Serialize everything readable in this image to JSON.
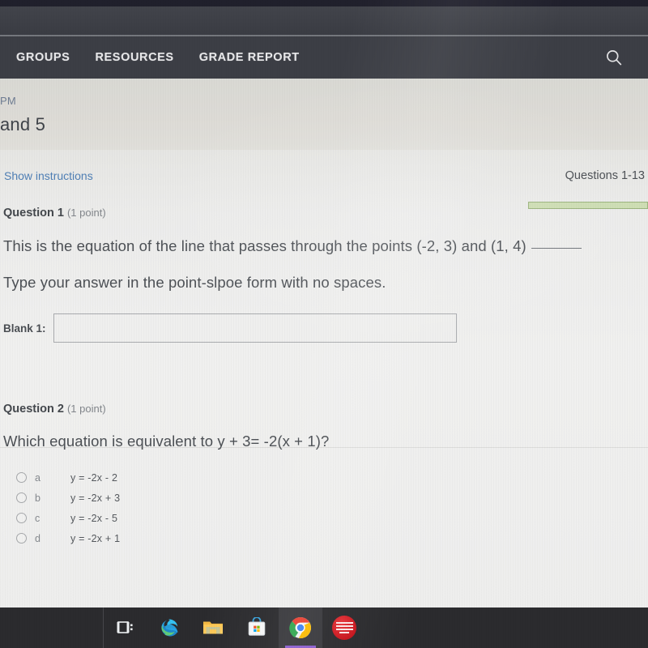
{
  "browser": {
    "chrome_strip": "dark-window-chrome"
  },
  "navbar": {
    "items": [
      {
        "label": "GROUPS",
        "name": "nav-item-groups"
      },
      {
        "label": "RESOURCES",
        "name": "nav-item-resources"
      },
      {
        "label": "GRADE REPORT",
        "name": "nav-item-grade-report"
      }
    ],
    "search_icon": "search-icon"
  },
  "page_header": {
    "time": "PM",
    "title": "and 5"
  },
  "instructions": {
    "show_instructions_label": "Show instructions",
    "questions_range": "Questions 1-13",
    "progress_percent": 100,
    "progress_fill_color": "#cdddb3",
    "progress_border_color": "#9ab37c"
  },
  "questions": [
    {
      "label": "Question 1",
      "points": "(1 point)",
      "line1": "This is the equation of the line that passes through the points (-2, 3) and (1, 4)",
      "line1_has_blank_rule": true,
      "line2": "Type your answer in the point-slpoe form with no spaces.",
      "blank_label": "Blank 1:",
      "blank_value": "",
      "blank_placeholder": ""
    },
    {
      "label": "Question 2",
      "points": "(1 point)",
      "text": "Which equation is equivalent to y + 3= -2(x + 1)?",
      "choices": [
        {
          "key": "a",
          "text": "y = -2x - 2",
          "selected": false
        },
        {
          "key": "b",
          "text": "y = -2x + 3",
          "selected": false
        },
        {
          "key": "c",
          "text": "y = -2x - 5",
          "selected": false
        },
        {
          "key": "d",
          "text": "y = -2x + 1",
          "selected": false
        }
      ]
    }
  ],
  "taskbar": {
    "buttons": [
      {
        "name": "task-view-icon",
        "label": "Task View"
      },
      {
        "name": "microsoft-edge-icon",
        "label": "Microsoft Edge"
      },
      {
        "name": "file-explorer-icon",
        "label": "File Explorer"
      },
      {
        "name": "microsoft-store-icon",
        "label": "Microsoft Store"
      },
      {
        "name": "google-chrome-icon",
        "label": "Google Chrome"
      },
      {
        "name": "ime-keyboard-icon",
        "label": "Input Method"
      }
    ],
    "active_index": 4,
    "active_underline_color": "#8c5fd0"
  }
}
